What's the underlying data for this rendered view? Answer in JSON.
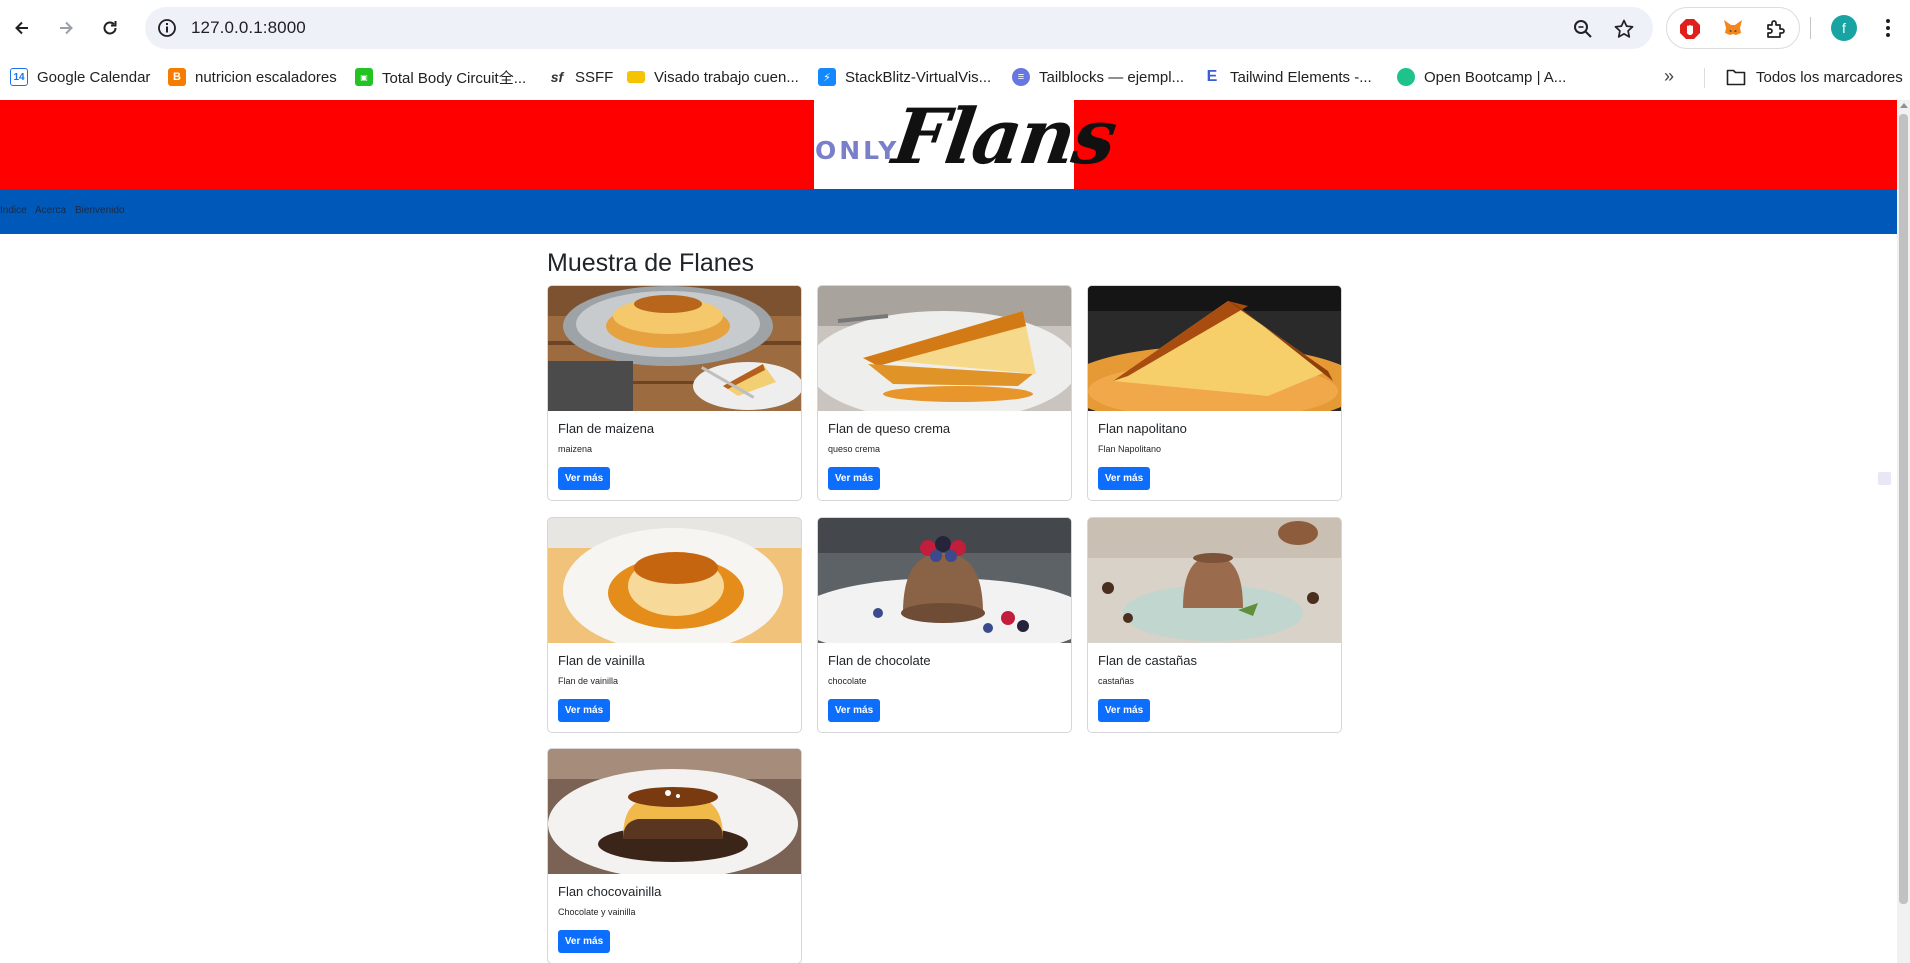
{
  "browser": {
    "url": "127.0.0.1:8000",
    "profile_initial": "f",
    "bookmarks": [
      {
        "label": "Google Calendar",
        "icon": "calendar-icon",
        "color": "#1a73e8"
      },
      {
        "label": "nutricion escaladores",
        "icon": "blogger-icon",
        "color": "#f57c00"
      },
      {
        "label": "Total Body Circuit全...",
        "icon": "game-icon",
        "color": "#22c322"
      },
      {
        "label": "SSFF",
        "icon": "sf-icon",
        "color": "#333333"
      },
      {
        "label": "Visado trabajo cuen...",
        "icon": "folder-doc-icon",
        "color": "#f5c400"
      },
      {
        "label": "StackBlitz-VirtualVis...",
        "icon": "stackblitz-icon",
        "color": "#1389fd"
      },
      {
        "label": "Tailblocks — ejempl...",
        "icon": "tailblocks-icon",
        "color": "#6876e0"
      },
      {
        "label": "Tailwind Elements -...",
        "icon": "tailwind-elements-icon",
        "color": "#3b5bdb"
      },
      {
        "label": "Open Bootcamp | A...",
        "icon": "openbootcamp-icon",
        "color": "#1ec28b"
      }
    ],
    "more_label": "»",
    "all_bookmarks_label": "Todos los marcadores"
  },
  "site": {
    "header_color": "#ff0000",
    "nav_color": "#0059b8",
    "logo_small": "ONLY",
    "logo_big": "Flans",
    "nav": [
      "Indice",
      "Acerca",
      "Bienvenido"
    ],
    "page_title": "Muestra de Flanes",
    "button_label": "Ver más",
    "flans": [
      {
        "title": "Flan de maizena",
        "text": "maizena",
        "image": "flan-plate-photo"
      },
      {
        "title": "Flan de queso crema",
        "text": "queso crema",
        "image": "cheese-flan-slice-photo"
      },
      {
        "title": "Flan napolitano",
        "text": "Flan Napolitano",
        "image": "napolitano-slice-photo"
      },
      {
        "title": "Flan de vainilla",
        "text": "Flan de vainilla",
        "image": "vanilla-flan-photo"
      },
      {
        "title": "Flan de chocolate",
        "text": "chocolate",
        "image": "chocolate-flan-berries-photo"
      },
      {
        "title": "Flan de castañas",
        "text": "castañas",
        "image": "chestnut-flan-photo"
      },
      {
        "title": "Flan chocovainilla",
        "text": "Chocolate y vainilla",
        "image": "chocovanilla-flan-photo"
      }
    ]
  }
}
